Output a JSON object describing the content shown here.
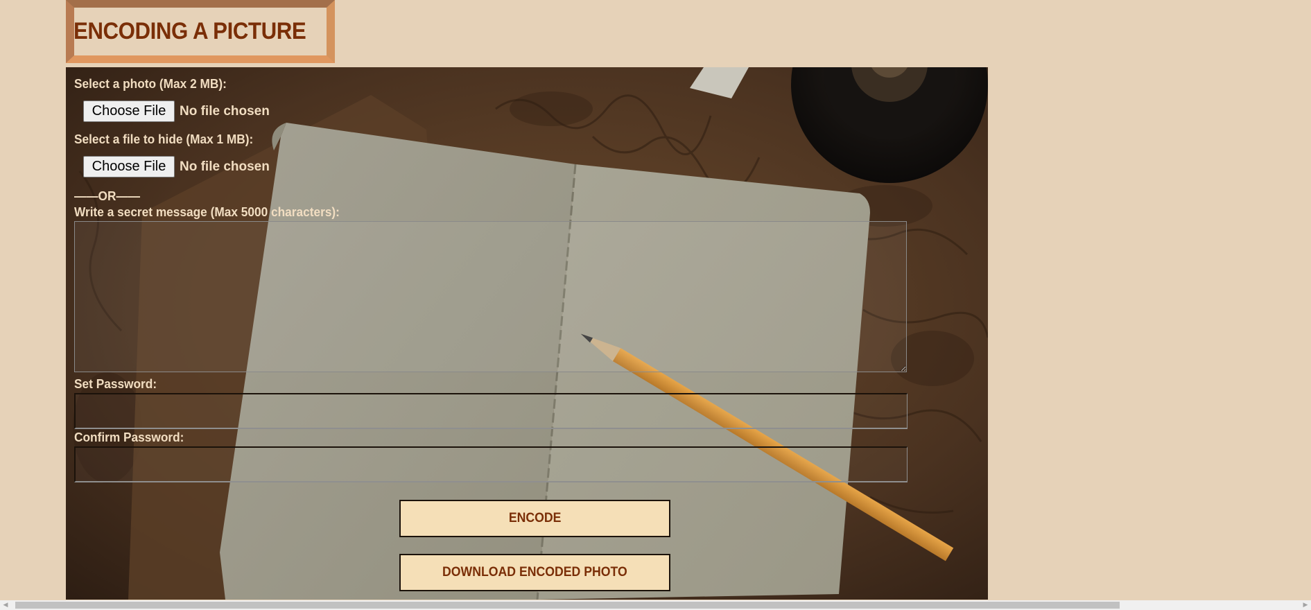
{
  "page": {
    "title": "ENCODING A PICTURE"
  },
  "form": {
    "photo_label": "Select a photo (Max 2 MB):",
    "photo_button": "Choose File",
    "photo_status": "No file chosen",
    "file_label": "Select a file to hide (Max 1 MB):",
    "file_button": "Choose File",
    "file_status": "No file chosen",
    "or_separator": "——OR——",
    "message_label": "Write a secret message (Max 5000 characters):",
    "message_value": "",
    "password_label": "Set Password:",
    "password_value": "",
    "confirm_label": "Confirm Password:",
    "confirm_value": "",
    "encode_button": "ENCODE",
    "download_button": "DOWNLOAD ENCODED PHOTO"
  },
  "background_image": {
    "icon": "notebook-map-camera-pencil-photo"
  },
  "colors": {
    "page_bg": "#e6d2b8",
    "title_text": "#7a2e07",
    "label_text": "#f1ddc1",
    "button_bg": "#f5dfb7"
  }
}
